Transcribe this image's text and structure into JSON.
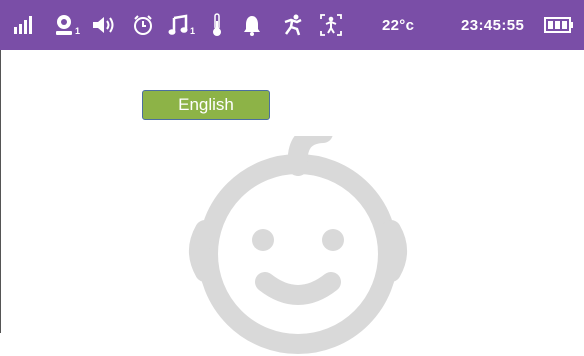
{
  "status_bar": {
    "background": "#7a4ea7",
    "icons": [
      "signal-strength-icon",
      "camera-icon",
      "speaker-volume-icon",
      "alarm-clock-icon",
      "lullaby-music-icon",
      "thermometer-icon",
      "notification-bell-icon",
      "motion-running-icon",
      "zoom-person-icon",
      "battery-icon"
    ],
    "camera_index": "1",
    "music_index": "1",
    "temperature": "22°c",
    "time": "23:45:55"
  },
  "main": {
    "language_button_label": "English",
    "language_button_color": "#8db347",
    "background_art": "baby-face-icon"
  }
}
